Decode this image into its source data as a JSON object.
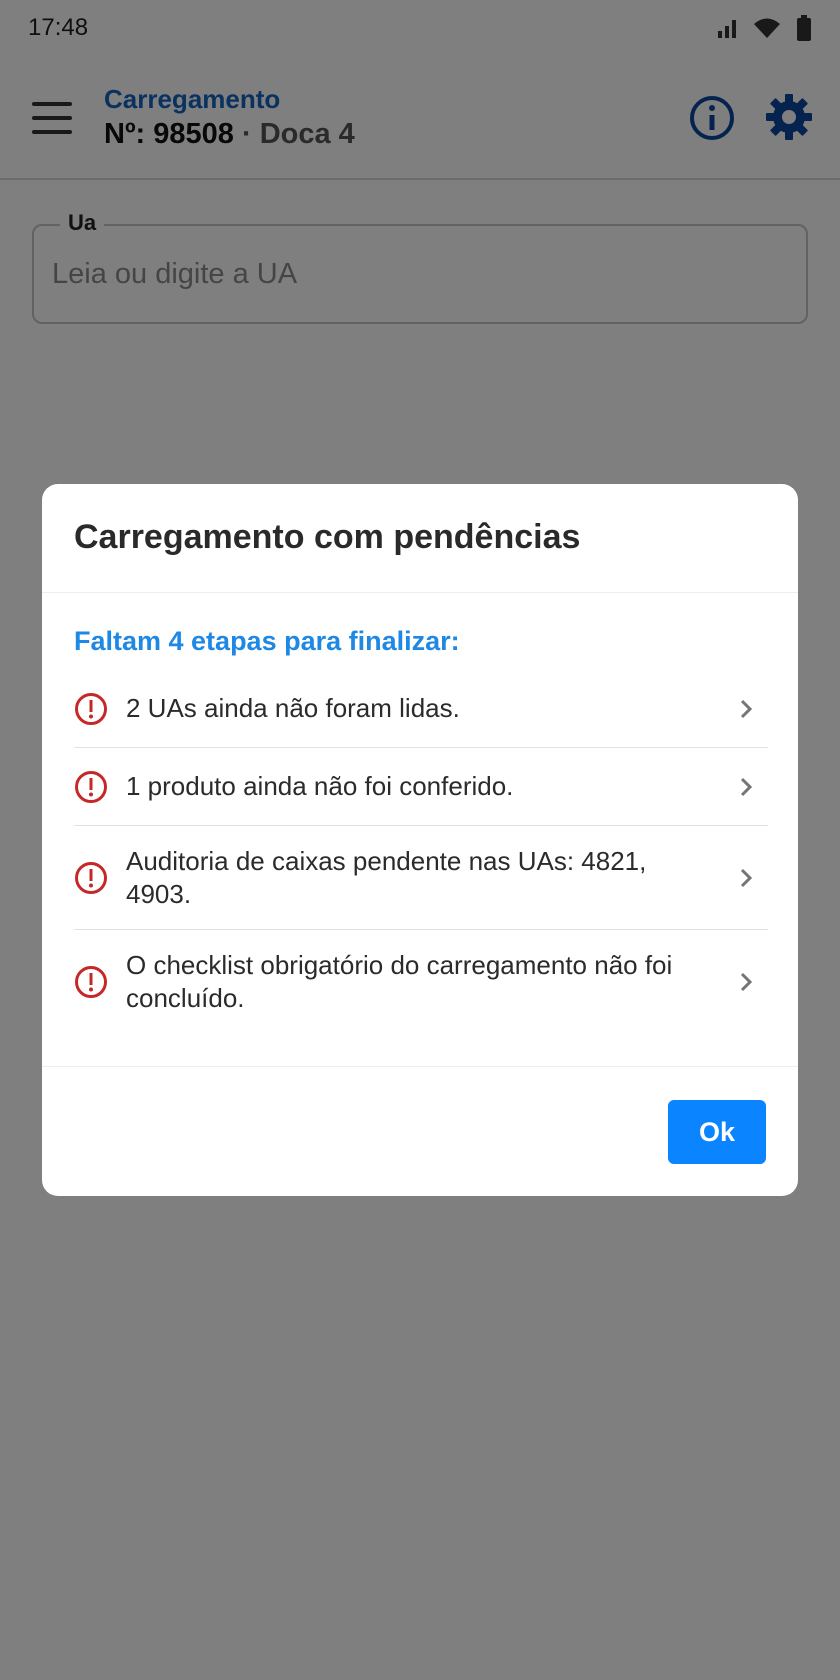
{
  "status_bar": {
    "time": "17:48",
    "icons": [
      "signal-icon",
      "wifi-icon",
      "battery-icon"
    ]
  },
  "header": {
    "title": "Carregamento",
    "number_label": "Nº: 98508",
    "separator": " · ",
    "dock": "Doca 4",
    "icons": [
      "menu-icon",
      "info-icon",
      "gear-icon"
    ]
  },
  "ua_field": {
    "label": "Ua",
    "placeholder": "Leia ou digite a UA",
    "value": ""
  },
  "dialog": {
    "title": "Carregamento com pendências",
    "subtitle": "Faltam 4 etapas para finalizar:",
    "items": [
      {
        "text": "2 UAs ainda não foram lidas.",
        "icon": "alert-circle-icon"
      },
      {
        "text": "1 produto ainda não foi conferido.",
        "icon": "alert-circle-icon"
      },
      {
        "text": "Auditoria de caixas pendente nas UAs: 4821, 4903.",
        "icon": "alert-circle-icon"
      },
      {
        "text": "O checklist obrigatório do carregamento não foi concluído.",
        "icon": "alert-circle-icon"
      }
    ],
    "ok_label": "Ok"
  },
  "colors": {
    "primary_blue": "#1565c0",
    "link_blue": "#1e88e5",
    "button_blue": "#0a84ff",
    "alert_red": "#c62828",
    "scrim": "rgba(0,0,0,0.5)"
  }
}
